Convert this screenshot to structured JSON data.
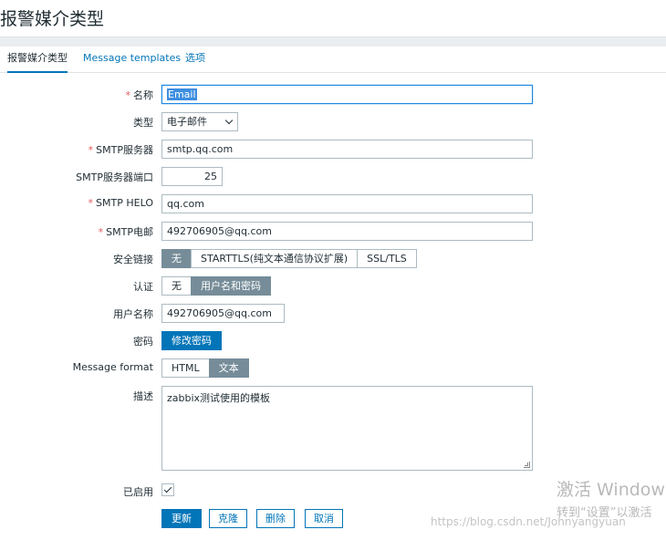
{
  "page": {
    "title": "报警媒介类型"
  },
  "tabs": [
    {
      "label": "报警媒介类型",
      "active": true
    },
    {
      "label": "Message templates",
      "active": false
    },
    {
      "label": "选项",
      "active": false
    }
  ],
  "form": {
    "name": {
      "label": "名称",
      "required": true,
      "value": "Email"
    },
    "type": {
      "label": "类型",
      "value": "电子邮件"
    },
    "smtp_server": {
      "label": "SMTP服务器",
      "required": true,
      "value": "smtp.qq.com"
    },
    "smtp_port": {
      "label": "SMTP服务器端口",
      "value": "25"
    },
    "smtp_helo": {
      "label": "SMTP HELO",
      "required": true,
      "value": "qq.com"
    },
    "smtp_email": {
      "label": "SMTP电邮",
      "required": true,
      "value": "492706905@qq.com"
    },
    "security": {
      "label": "安全链接",
      "options": [
        "无",
        "STARTTLS(纯文本通信协议扩展)",
        "SSL/TLS"
      ],
      "selected": "无"
    },
    "auth": {
      "label": "认证",
      "options": [
        "无",
        "用户名和密码"
      ],
      "selected": "用户名和密码"
    },
    "username": {
      "label": "用户名称",
      "value": "492706905@qq.com"
    },
    "password": {
      "label": "密码",
      "button": "修改密码"
    },
    "message_format": {
      "label": "Message format",
      "options": [
        "HTML",
        "文本"
      ],
      "selected": "文本"
    },
    "description": {
      "label": "描述",
      "value": "zabbix测试使用的模板"
    },
    "enabled": {
      "label": "已启用",
      "checked": true
    }
  },
  "actions": {
    "update": "更新",
    "clone": "克隆",
    "delete": "删除",
    "cancel": "取消"
  },
  "overlay": {
    "windows_line1": "激活 Windows",
    "windows_line2": "转到“设置”以激活",
    "csdn_url": "https://blog.csdn.net/Johnyangyuan"
  },
  "colors": {
    "accent": "#0275b8",
    "toggle_on": "#768d99",
    "required": "#e45959"
  }
}
